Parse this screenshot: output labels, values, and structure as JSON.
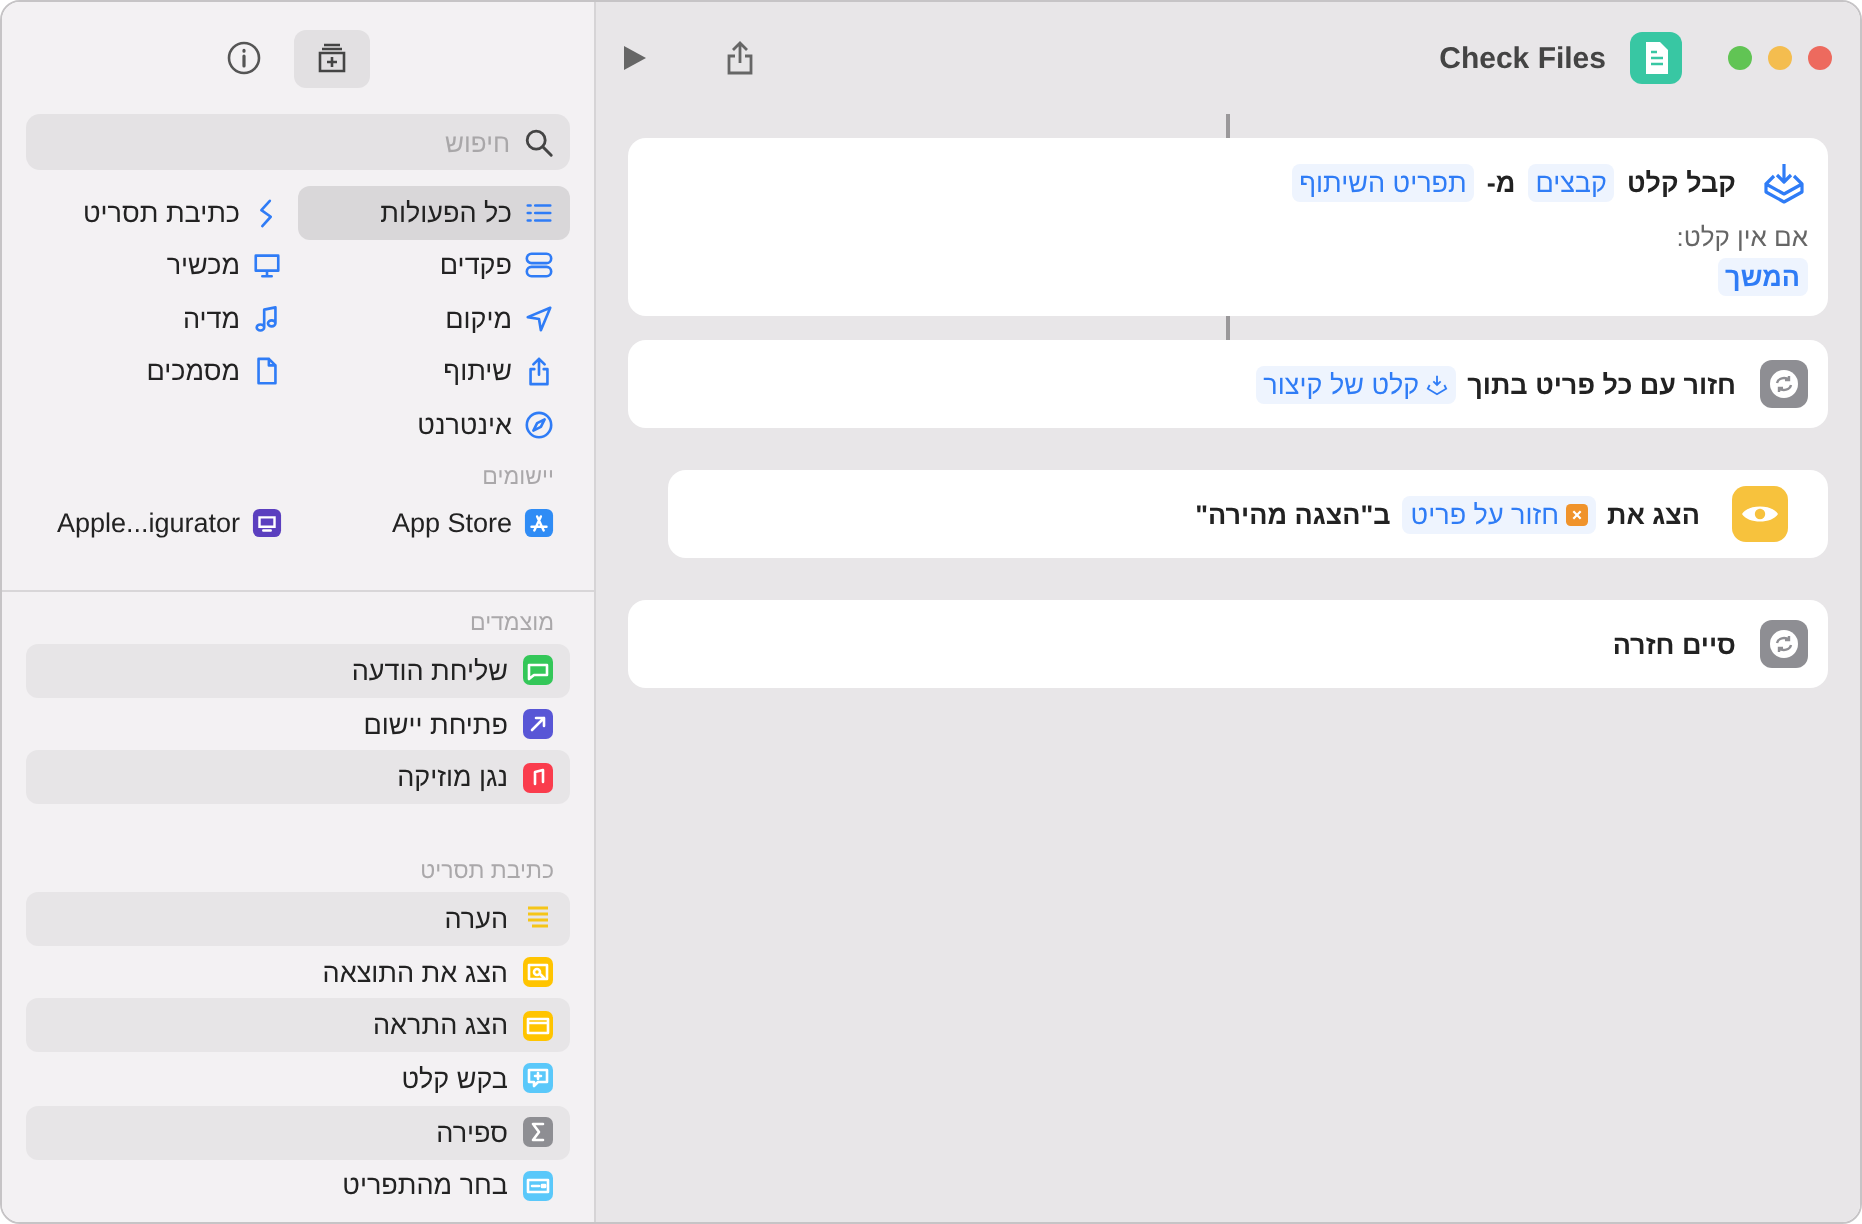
{
  "window": {
    "title": "Check Files"
  },
  "sidebar": {
    "search": {
      "placeholder": "חיפוש"
    },
    "categories": [
      {
        "label": "כל הפעולות",
        "selected": true
      },
      {
        "label": "כתיבת תסריט",
        "selected": false
      },
      {
        "label": "פקדים",
        "selected": false
      },
      {
        "label": "מכשיר",
        "selected": false
      },
      {
        "label": "מיקום",
        "selected": false
      },
      {
        "label": "מדיה",
        "selected": false
      },
      {
        "label": "שיתוף",
        "selected": false
      },
      {
        "label": "מסמכים",
        "selected": false
      },
      {
        "label": "אינטרנט",
        "selected": false
      }
    ],
    "apps_header": "יישומים",
    "apps": [
      {
        "label": "App Store",
        "color": "#2f8cf5"
      },
      {
        "label": "Apple...igurator",
        "color": "#5b3fbf"
      }
    ],
    "sections": [
      {
        "title": "מוצמדים",
        "items": [
          {
            "label": "שליחת הודעה",
            "kind": "tile",
            "color": "#34c759"
          },
          {
            "label": "פתיחת יישום",
            "kind": "tile",
            "color": "#5856d6"
          },
          {
            "label": "נגן מוזיקה",
            "kind": "tile",
            "color": "#fa3c4d"
          }
        ]
      },
      {
        "title": "כתיבת תסריט",
        "items": [
          {
            "label": "הערה",
            "kind": "plain",
            "color": "#f5c518"
          },
          {
            "label": "הצג את התוצאה",
            "kind": "tile",
            "color": "#ffc400"
          },
          {
            "label": "הצג התראה",
            "kind": "tile",
            "color": "#ffc400"
          },
          {
            "label": "בקש קלט",
            "kind": "tile",
            "color": "#5ac8fa"
          },
          {
            "label": "ספירה",
            "kind": "tile",
            "color": "#8e8e93"
          },
          {
            "label": "בחר מהתפריט",
            "kind": "tile",
            "color": "#5ac8fa"
          }
        ]
      }
    ]
  },
  "actions": [
    {
      "kind": "receive",
      "indented": false,
      "parts": [
        {
          "kind": "text",
          "text": "קבל קלט"
        },
        {
          "kind": "token",
          "text": "קבצים"
        },
        {
          "kind": "text",
          "text": "מ-"
        },
        {
          "kind": "token",
          "text": "תפריט השיתוף"
        }
      ],
      "note": "אם אין קלט:",
      "note_token": "המשך"
    },
    {
      "kind": "repeat",
      "indented": false,
      "parts": [
        {
          "kind": "text",
          "text": "חזור עם כל פריט בתוך"
        },
        {
          "kind": "input-token",
          "text": "קלט של קיצור"
        }
      ]
    },
    {
      "kind": "show",
      "indented": true,
      "parts": [
        {
          "kind": "text",
          "text": "הצג את"
        },
        {
          "kind": "variable-token",
          "text": "חזור על פריט"
        },
        {
          "kind": "text",
          "text": "ב\"הצגה מהירה\""
        }
      ]
    },
    {
      "kind": "repeat",
      "indented": false,
      "parts": [
        {
          "kind": "text",
          "text": "סיים חזרה"
        }
      ]
    }
  ]
}
